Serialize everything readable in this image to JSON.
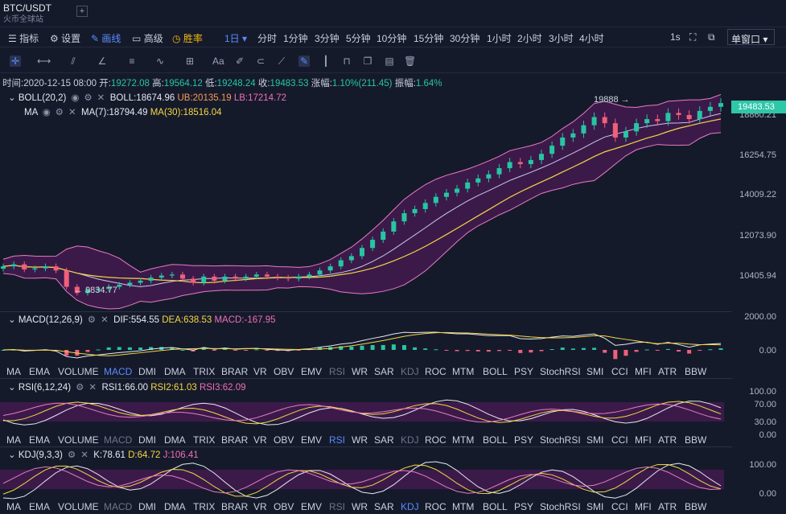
{
  "header": {
    "symbol": "BTC/USDT",
    "exchange": "火币全球站",
    "add_tab": "+"
  },
  "toolbar": {
    "items": [
      "指标",
      "设置",
      "画线",
      "高级",
      "胜率"
    ],
    "timeframes": [
      "1日",
      "分时",
      "1分钟",
      "3分钟",
      "5分钟",
      "10分钟",
      "15分钟",
      "30分钟",
      "1小时",
      "2小时",
      "3小时",
      "4小时"
    ],
    "right": [
      "1s"
    ],
    "window_select": "单窗口"
  },
  "draw_tools": [
    "crosshair-icon",
    "horizontal-line-icon",
    "parallel-lines-icon",
    "ray-icon",
    "channel-icon",
    "wave-icon",
    "box-icon",
    "text-icon",
    "brush-icon",
    "magnet-icon",
    "ruler-icon",
    "pencil-icon",
    "bar-pattern-icon",
    "lock-icon",
    "copy-icon",
    "layers-icon",
    "trash-icon"
  ],
  "ohlc": {
    "time_label": "时间:",
    "time": "2020-12-15 08:00",
    "open_label": "开:",
    "open": "19272.08",
    "high_label": "高:",
    "high": "19564.12",
    "low_label": "低:",
    "low": "19248.24",
    "close_label": "收:",
    "close": "19483.53",
    "change_label": "涨幅:",
    "change": "1.10%(211.45)",
    "amp_label": "振幅:",
    "amp": "1.64%"
  },
  "main_indicators": {
    "boll_name": "BOLL(20,2)",
    "boll_val": "BOLL:18674.96",
    "boll_ub": "UB:20135.19",
    "boll_lb": "LB:17214.72",
    "ma_name": "MA",
    "ma7": "MA(7):18794.49",
    "ma30": "MA(30):18516.04"
  },
  "price_axis": [
    "18860.21",
    "16254.75",
    "14009.22",
    "12073.90",
    "10405.94"
  ],
  "price_tag": "19483.53",
  "annotations": {
    "high": "19888",
    "low": "9834.77"
  },
  "macd": {
    "name": "MACD(12,26,9)",
    "dif": "DIF:554.55",
    "dea": "DEA:638.53",
    "macd": "MACD:-167.95",
    "axis": [
      "2000.00",
      "0.00"
    ]
  },
  "rsi": {
    "name": "RSI(6,12,24)",
    "r1": "RSI1:66.00",
    "r2": "RSI2:61.03",
    "r3": "RSI3:62.09",
    "axis": [
      "100.00",
      "70.00",
      "30.00",
      "0.00"
    ]
  },
  "kdj": {
    "name": "KDJ(9,3,3)",
    "k": "K:78.61",
    "d": "D:64.72",
    "j": "J:106.41",
    "axis": [
      "100.00",
      "0.00"
    ]
  },
  "indicator_tabs": [
    "MA",
    "EMA",
    "VOLUME",
    "MACD",
    "DMI",
    "DMA",
    "TRIX",
    "BRAR",
    "VR",
    "OBV",
    "EMV",
    "RSI",
    "WR",
    "SAR",
    "KDJ",
    "ROC",
    "MTM",
    "BOLL",
    "PSY",
    "StochRSI",
    "SMI",
    "CCI",
    "MFI",
    "ATR",
    "BBW"
  ],
  "colors": {
    "up": "#26c6a2",
    "down": "#f0607a",
    "band_fill": "#3b1a4a",
    "band_line": "#e87cc0",
    "ma7": "#c9c9e8",
    "ma30": "#f5d742"
  },
  "chart_data": {
    "type": "candlestick",
    "note": "",
    "closes": [
      11500,
      11600,
      11350,
      11400,
      11500,
      11300,
      10500,
      10200,
      10350,
      10400,
      10500,
      10600,
      10700,
      10800,
      10950,
      11050,
      11100,
      10900,
      10700,
      11000,
      10800,
      11000,
      10900,
      11000,
      11100,
      11000,
      10950,
      10900,
      11000,
      11100,
      11300,
      11500,
      11800,
      12000,
      12400,
      12800,
      13200,
      13700,
      14100,
      14300,
      14600,
      14900,
      15100,
      15300,
      15600,
      15800,
      16000,
      16300,
      16600,
      16500,
      16700,
      17000,
      17400,
      17800,
      18000,
      18400,
      18800,
      18500,
      17800,
      18100,
      18500,
      18700,
      18600,
      19000,
      18900,
      18700,
      19100,
      19300,
      19483
    ],
    "price_range": [
      9500,
      20000
    ]
  }
}
